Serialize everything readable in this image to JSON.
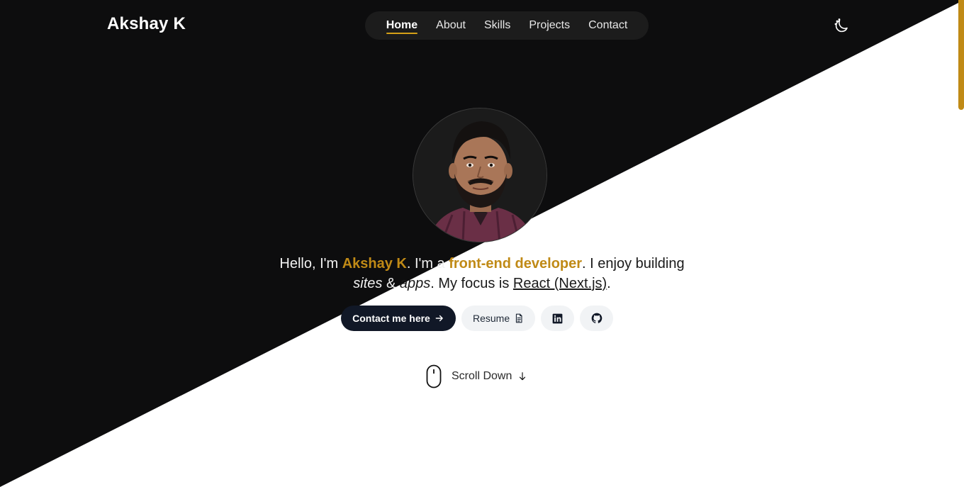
{
  "header": {
    "brand": "Akshay K",
    "nav": [
      {
        "label": "Home",
        "active": true
      },
      {
        "label": "About",
        "active": false
      },
      {
        "label": "Skills",
        "active": false
      },
      {
        "label": "Projects",
        "active": false
      },
      {
        "label": "Contact",
        "active": false
      }
    ],
    "theme_toggle_icon": "moon-icon"
  },
  "hero": {
    "avatar_icon": "profile-photo",
    "intro": {
      "greeting": "Hello, I'm ",
      "name": "Akshay K",
      "mid1": ". I'm a ",
      "role": "front-end developer",
      "mid2": ". I enjoy building ",
      "sites": "sites",
      "amp": " & ",
      "apps": "apps",
      "mid3": ". My focus is ",
      "focus": "React (Next.js)",
      "end": "."
    },
    "buttons": {
      "contact": "Contact me here",
      "contact_icon": "arrow-right-icon",
      "resume": "Resume",
      "resume_icon": "document-icon",
      "linkedin_icon": "linkedin-icon",
      "github_icon": "github-icon"
    },
    "scroll": {
      "label": "Scroll Down",
      "mouse_icon": "mouse-icon",
      "arrow_icon": "arrow-down-icon"
    }
  },
  "colors": {
    "accent": "#c08a16",
    "dark": "#0d0d0e",
    "primary_button": "#111827"
  }
}
